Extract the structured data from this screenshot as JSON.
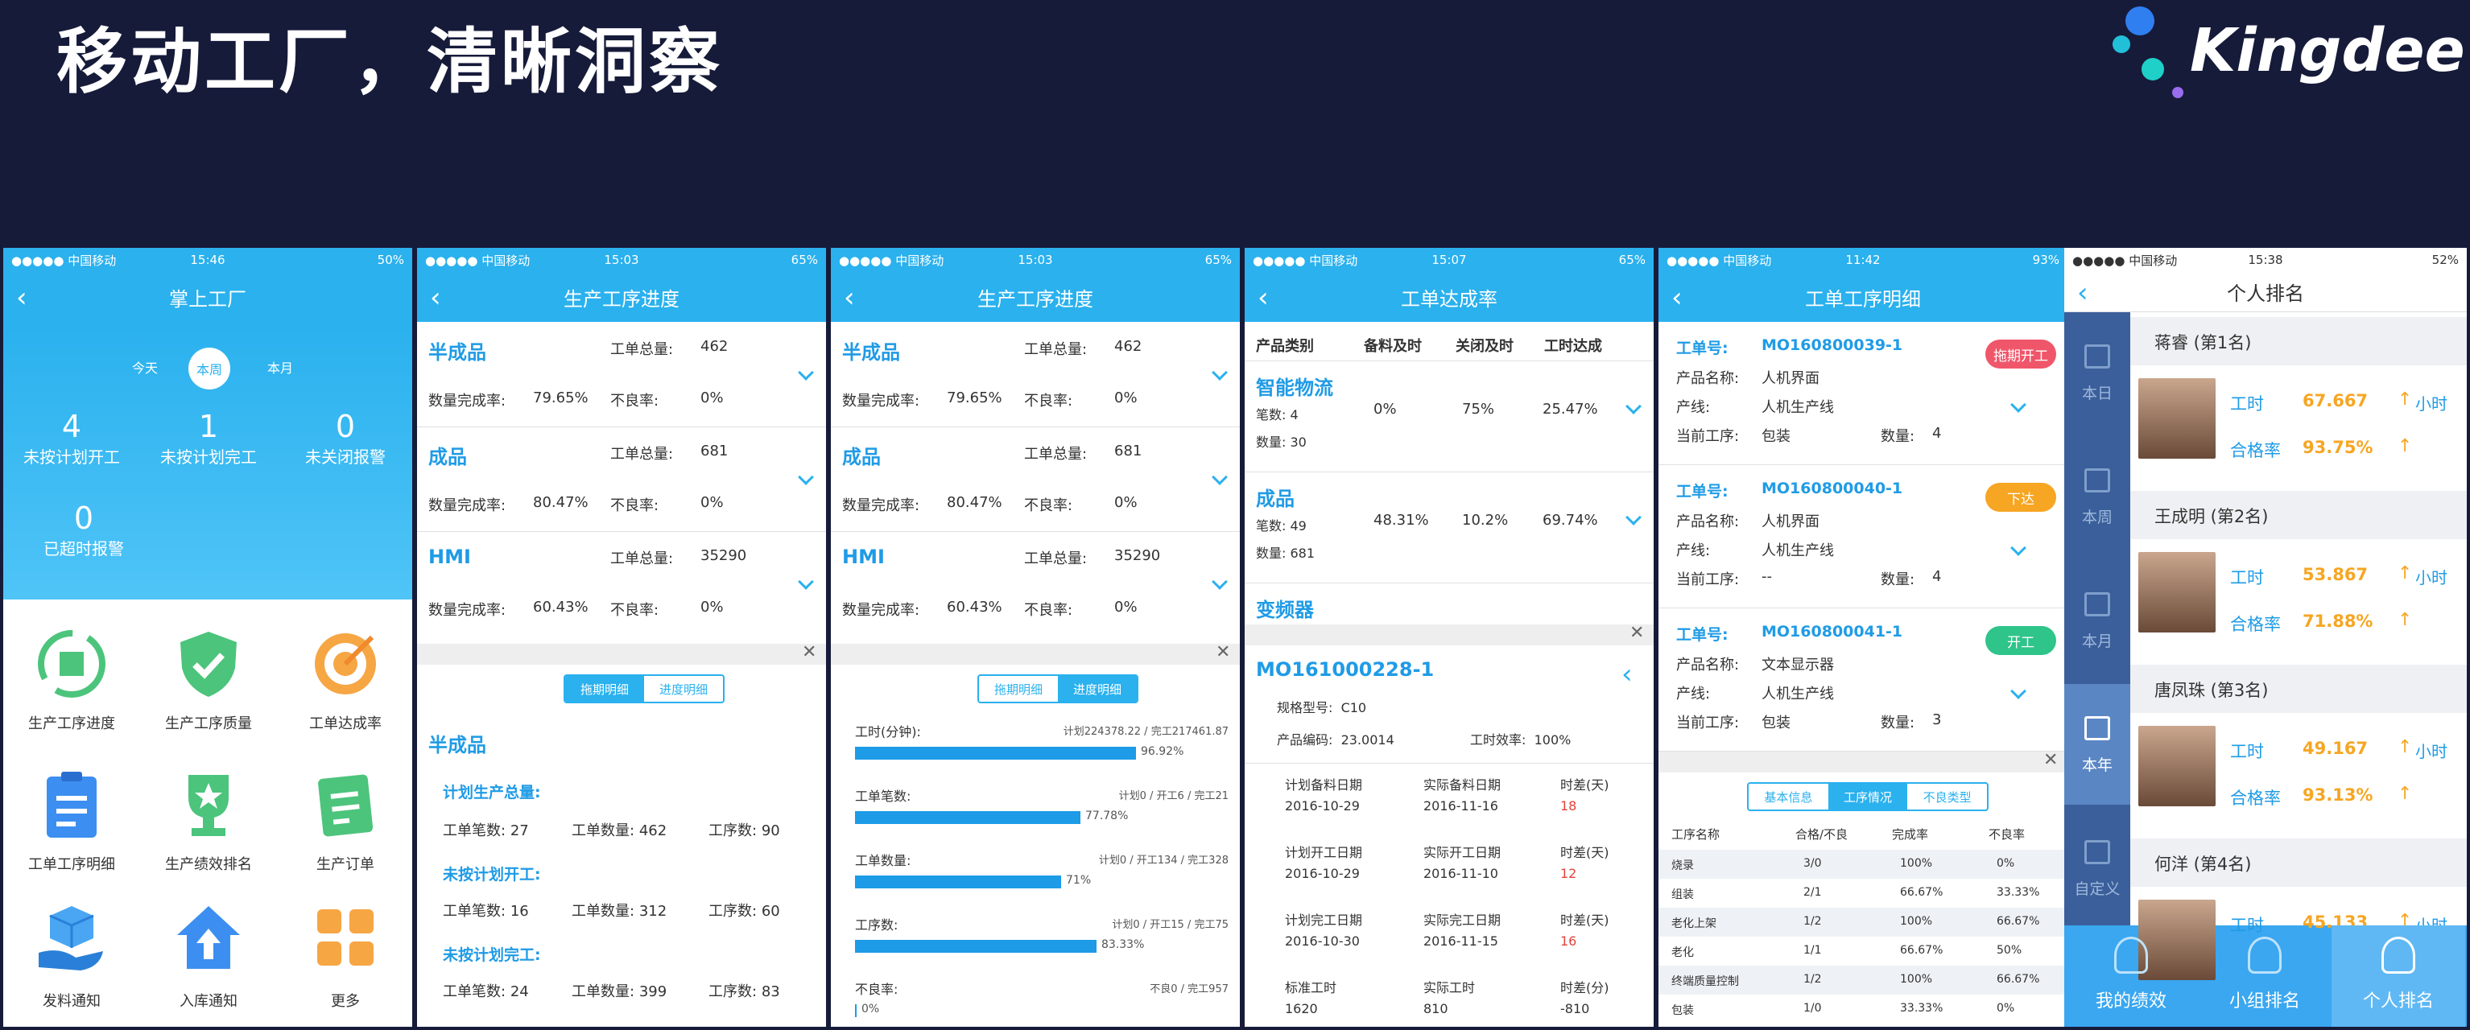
{
  "title": "移动工厂，清晰洞察",
  "logo": "Kingdee",
  "p1": {
    "carrier": "●●●●● 中国移动",
    "time": "15:46",
    "battery": "50%",
    "nav": "掌上工厂",
    "tabs": [
      "今天",
      "本周",
      "本月"
    ],
    "stats": [
      {
        "n": "4",
        "l": "未按计划开工"
      },
      {
        "n": "1",
        "l": "未按计划完工"
      },
      {
        "n": "0",
        "l": "未关闭报警"
      },
      {
        "n": "0",
        "l": "已超时报警"
      }
    ],
    "grid": [
      "生产工序进度",
      "生产工序质量",
      "工单达成率",
      "工单工序明细",
      "生产绩效排名",
      "生产订单",
      "发料通知",
      "入库通知",
      "更多"
    ]
  },
  "p2": {
    "carrier": "●●●●● 中国移动",
    "time": "15:03",
    "battery": "65%",
    "nav": "生产工序进度",
    "items": [
      {
        "n": "半成品",
        "total": "462",
        "rate": "79.65%",
        "bad": "0%"
      },
      {
        "n": "成品",
        "total": "681",
        "rate": "80.47%",
        "bad": "0%"
      },
      {
        "n": "HMI",
        "total": "35290",
        "rate": "60.43%",
        "bad": "0%"
      }
    ],
    "lbl_total": "工单总量:",
    "lbl_rate": "数量完成率:",
    "lbl_bad": "不良率:",
    "tab1": "拖期明细",
    "tab2": "进度明细",
    "sec": "半成品",
    "g1": "计划生产总量:",
    "g2": "未按计划开工:",
    "g3": "未按计划完工:",
    "lbl_a": "工单笔数:",
    "lbl_b": "工单数量:",
    "lbl_c": "工序数:",
    "rows": [
      [
        "27",
        "462",
        "90"
      ],
      [
        "16",
        "312",
        "60"
      ],
      [
        "24",
        "399",
        "83"
      ]
    ]
  },
  "p3": {
    "carrier": "●●●●● 中国移动",
    "time": "15:03",
    "battery": "65%",
    "nav": "生产工序进度",
    "bars": [
      {
        "l": "工时(分钟):",
        "r": "计划224378.22 / 完工217461.87",
        "pct": "96.92%",
        "v": 0.9692
      },
      {
        "l": "工单笔数:",
        "r": "计划0 / 开工6 / 完工21",
        "pct": "77.78%",
        "v": 0.7778
      },
      {
        "l": "工单数量:",
        "r": "计划0 / 开工134 / 完工328",
        "pct": "71%",
        "v": 0.71
      },
      {
        "l": "工序数:",
        "r": "计划0 / 开工15 / 完工75",
        "pct": "83.33%",
        "v": 0.8333
      },
      {
        "l": "不良率:",
        "r": "不良0 / 完工957",
        "pct": "0%",
        "v": 0
      }
    ]
  },
  "p4": {
    "carrier": "●●●●● 中国移动",
    "time": "15:07",
    "battery": "65%",
    "nav": "工单达成率",
    "head": [
      "产品类别",
      "备料及时",
      "关闭及时",
      "工时达成"
    ],
    "cats": [
      {
        "n": "智能物流",
        "a": "0%",
        "b": "75%",
        "c": "25.47%",
        "cnt": "笔数: 4",
        "qty": "数量: 30"
      },
      {
        "n": "成品",
        "a": "48.31%",
        "b": "10.2%",
        "c": "69.74%",
        "cnt": "笔数: 49",
        "qty": "数量: 681"
      },
      {
        "n": "变频器"
      }
    ],
    "mo": "MO161000228-1",
    "spec_l": "规格型号:",
    "spec": "C10",
    "code_l": "产品编码:",
    "code": "23.0014",
    "eff_l": "工时效率:",
    "eff": "100%",
    "d": [
      [
        "计划备料日期",
        "实际备料日期",
        "时差(天)"
      ],
      [
        "2016-10-29",
        "2016-11-16",
        "18"
      ],
      [
        "计划开工日期",
        "实际开工日期",
        "时差(天)"
      ],
      [
        "2016-10-29",
        "2016-11-10",
        "12"
      ],
      [
        "计划完工日期",
        "实际完工日期",
        "时差(天)"
      ],
      [
        "2016-10-30",
        "2016-11-15",
        "16"
      ],
      [
        "标准工时",
        "实际工时",
        "时差(分)"
      ],
      [
        "1620",
        "810",
        "-810"
      ]
    ]
  },
  "p5": {
    "carrier": "●●●●● 中国移动",
    "time": "11:42",
    "battery": "93%",
    "nav": "工单工序明细",
    "lbl_no": "工单号:",
    "lbl_name": "产品名称:",
    "lbl_line": "产线:",
    "lbl_cur": "当前工序:",
    "lbl_qty": "数量:",
    "orders": [
      {
        "no": "MO160800039-1",
        "name": "人机界面",
        "line": "人机生产线",
        "cur": "包装",
        "qty": "4",
        "st": "拖期开工",
        "col": "#f0566a"
      },
      {
        "no": "MO160800040-1",
        "name": "人机界面",
        "line": "人机生产线",
        "cur": "--",
        "qty": "4",
        "st": "下达",
        "col": "#f6a623"
      },
      {
        "no": "MO160800041-1",
        "name": "文本显示器",
        "line": "人机生产线",
        "cur": "包装",
        "qty": "3",
        "st": "开工",
        "col": "#2ec48a"
      }
    ],
    "tabs": [
      "基本信息",
      "工序情况",
      "不良类型"
    ],
    "th": [
      "工序名称",
      "合格/不良",
      "完成率",
      "不良率"
    ],
    "tr": [
      [
        "烧录",
        "3/0",
        "100%",
        "0%"
      ],
      [
        "组装",
        "2/1",
        "66.67%",
        "33.33%"
      ],
      [
        "老化上架",
        "1/2",
        "100%",
        "66.67%"
      ],
      [
        "老化",
        "1/1",
        "66.67%",
        "50%"
      ],
      [
        "终端质量控制",
        "1/2",
        "100%",
        "66.67%"
      ],
      [
        "包装",
        "1/0",
        "33.33%",
        "0%"
      ]
    ]
  },
  "p6": {
    "carrier": "●●●●● 中国移动",
    "time": "15:38",
    "battery": "52%",
    "nav": "个人排名",
    "side": [
      "本日",
      "本周",
      "本月",
      "本年",
      "自定义"
    ],
    "lbl_h": "工时",
    "lbl_q": "合格率",
    "unit": "小时",
    "people": [
      {
        "n": "蒋睿 (第1名)",
        "h": "67.667",
        "q": "93.75%"
      },
      {
        "n": "王成明 (第2名)",
        "h": "53.867",
        "q": "71.88%"
      },
      {
        "n": "唐凤珠 (第3名)",
        "h": "49.167",
        "q": "93.13%"
      },
      {
        "n": "何洋 (第4名)",
        "h": "45.133"
      }
    ],
    "tabs": [
      "我的绩效",
      "小组排名",
      "个人排名"
    ]
  }
}
